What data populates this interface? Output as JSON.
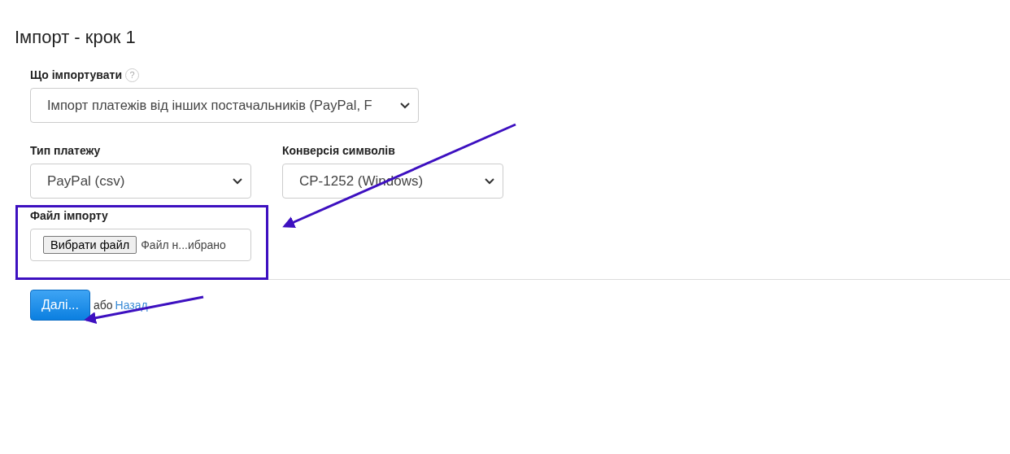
{
  "title": "Імпорт - крок 1",
  "what": {
    "label": "Що імпортувати",
    "help": "?",
    "value": "Імпорт платежів від інших постачальників (PayPal, F"
  },
  "row": [
    {
      "label": "Тип платежу",
      "value": "PayPal (csv)"
    },
    {
      "label": "Конверсія символів",
      "value": "CP-1252 (Windows)"
    }
  ],
  "file": {
    "label": "Файл імпорту",
    "button": "Вибрати файл",
    "status": "Файл н...ибрано"
  },
  "actions": {
    "next": "Далі...",
    "or": "або",
    "back": "Назад"
  },
  "annotations": [
    {
      "kind": "box"
    },
    {
      "kind": "arrow-to-file"
    },
    {
      "kind": "arrow-to-next"
    }
  ]
}
